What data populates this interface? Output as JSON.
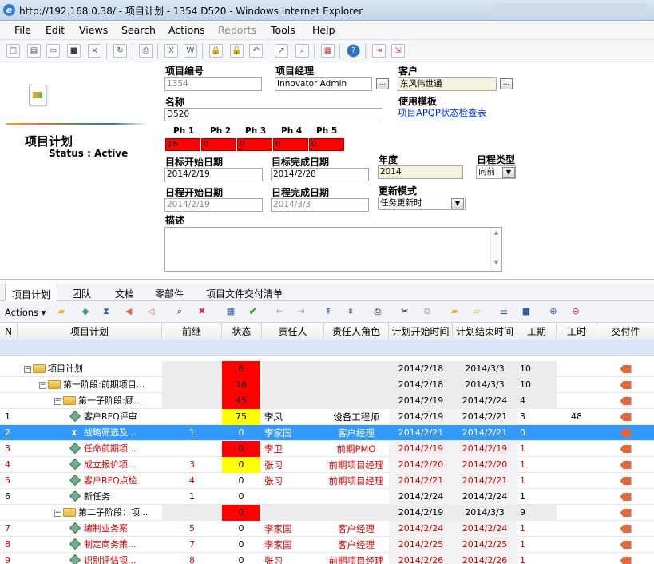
{
  "window": {
    "title": "http://192.168.0.38/ - 项目计划 - 1354 D520 - Windows Internet Explorer"
  },
  "menu": [
    "File",
    "Edit",
    "Views",
    "Search",
    "Actions",
    "Reports",
    "Tools",
    "Help"
  ],
  "header": {
    "page_title": "项目计划",
    "status": "Status : Active",
    "project_no_label": "项目编号",
    "project_no": "1354",
    "manager_label": "项目经理",
    "manager": "Innovator Admin",
    "customer_label": "客户",
    "customer": "东风伟世通",
    "template_label": "使用模板",
    "template_link": "项目APQP状态检查表",
    "name_label": "名称",
    "name": "D520",
    "phases": [
      {
        "label": "Ph 1",
        "value": "16"
      },
      {
        "label": "Ph 2",
        "value": "0"
      },
      {
        "label": "Ph 3",
        "value": "0"
      },
      {
        "label": "Ph 4",
        "value": "0"
      },
      {
        "label": "Ph 5",
        "value": "0"
      }
    ],
    "target_start_label": "目标开始日期",
    "target_start": "2014/2/19",
    "target_end_label": "目标完成日期",
    "target_end": "2014/2/28",
    "year_label": "年度",
    "year": "2014",
    "sched_type_label": "日程类型",
    "sched_type": "向前",
    "sched_start_label": "日程开始日期",
    "sched_start": "2014/2/19",
    "sched_end_label": "日程完成日期",
    "sched_end": "2014/3/3",
    "update_mode_label": "更新模式",
    "update_mode": "任务更新时",
    "desc_label": "描述"
  },
  "tabs": [
    "项目计划",
    "团队",
    "文档",
    "零部件",
    "项目文件交付清单"
  ],
  "grid": {
    "actions_label": "Actions",
    "columns": [
      "N",
      "项目计划",
      "前继",
      "状态",
      "责任人",
      "责任人角色",
      "计划开始时间",
      "计划结束时间",
      "工期",
      "工时",
      "交付件"
    ],
    "rows": [
      {
        "n": "",
        "name": "项目计划",
        "pre": "",
        "status": "6",
        "owner": "",
        "role": "",
        "ps": "2014/2/18",
        "pe": "2014/3/3",
        "dur": "10",
        "hr": "",
        "level": 0,
        "type": "folder",
        "st_color": "red",
        "red": false
      },
      {
        "n": "",
        "name": "第一阶段:前期项目...",
        "pre": "",
        "status": "16",
        "owner": "",
        "role": "",
        "ps": "2014/2/18",
        "pe": "2014/3/3",
        "dur": "10",
        "hr": "",
        "level": 1,
        "type": "folder",
        "st_color": "red",
        "red": false
      },
      {
        "n": "",
        "name": "第一子阶段:顾...",
        "pre": "",
        "status": "45",
        "owner": "",
        "role": "",
        "ps": "2014/2/19",
        "pe": "2014/2/24",
        "dur": "4",
        "hr": "",
        "level": 2,
        "type": "folder",
        "st_color": "red",
        "red": false
      },
      {
        "n": "1",
        "name": "客户RFQ评审",
        "pre": "",
        "status": "75",
        "owner": "李凤",
        "role": "设备工程师",
        "ps": "2014/2/19",
        "pe": "2014/2/21",
        "dur": "3",
        "hr": "48",
        "level": 3,
        "type": "task",
        "st_color": "yellow",
        "red": false
      },
      {
        "n": "2",
        "name": "战略筛选及...",
        "pre": "1",
        "status": "0",
        "owner": "李家国",
        "role": "客户经理",
        "ps": "2014/2/21",
        "pe": "2014/2/21",
        "dur": "0",
        "hr": "",
        "level": 3,
        "type": "milestone",
        "st_color": "",
        "red": false,
        "selected": true
      },
      {
        "n": "3",
        "name": "任命前期项...",
        "pre": "",
        "status": "0",
        "owner": "李卫",
        "role": "前期PMO",
        "ps": "2014/2/19",
        "pe": "2014/2/19",
        "dur": "1",
        "hr": "",
        "level": 3,
        "type": "task",
        "st_color": "red",
        "red": true
      },
      {
        "n": "4",
        "name": "成立报价项...",
        "pre": "3",
        "status": "0",
        "owner": "张习",
        "role": "前期项目经理",
        "ps": "2014/2/20",
        "pe": "2014/2/20",
        "dur": "1",
        "hr": "",
        "level": 3,
        "type": "task",
        "st_color": "yellow",
        "red": true
      },
      {
        "n": "5",
        "name": "客户RFQ点检",
        "pre": "4",
        "status": "0",
        "owner": "张习",
        "role": "前期项目经理",
        "ps": "2014/2/21",
        "pe": "2014/2/21",
        "dur": "1",
        "hr": "",
        "level": 3,
        "type": "task",
        "st_color": "",
        "red": true
      },
      {
        "n": "6",
        "name": "新任务",
        "pre": "1",
        "status": "0",
        "owner": "",
        "role": "",
        "ps": "2014/2/24",
        "pe": "2014/2/24",
        "dur": "1",
        "hr": "",
        "level": 3,
        "type": "task",
        "st_color": "",
        "red": false
      },
      {
        "n": "",
        "name": "第二子阶段：项...",
        "pre": "",
        "status": "0",
        "owner": "",
        "role": "",
        "ps": "2014/2/19",
        "pe": "2014/3/3",
        "dur": "9",
        "hr": "",
        "level": 2,
        "type": "folder",
        "st_color": "red",
        "red": false
      },
      {
        "n": "7",
        "name": "编制业务案",
        "pre": "5",
        "status": "0",
        "owner": "李家国",
        "role": "客户经理",
        "ps": "2014/2/24",
        "pe": "2014/2/24",
        "dur": "1",
        "hr": "",
        "level": 3,
        "type": "task",
        "st_color": "",
        "red": true
      },
      {
        "n": "8",
        "name": "制定商务策...",
        "pre": "7",
        "status": "0",
        "owner": "李家国",
        "role": "客户经理",
        "ps": "2014/2/25",
        "pe": "2014/2/25",
        "dur": "1",
        "hr": "",
        "level": 3,
        "type": "task",
        "st_color": "",
        "red": true
      },
      {
        "n": "9",
        "name": "识别评估项...",
        "pre": "8",
        "status": "0",
        "owner": "张习",
        "role": "前期项目经理",
        "ps": "2014/2/26",
        "pe": "2014/2/26",
        "dur": "1",
        "hr": "",
        "level": 3,
        "type": "task",
        "st_color": "",
        "red": true
      }
    ]
  },
  "colors": {
    "red": "#ff0000",
    "yellow": "#ffff00",
    "selected": "#3399ff",
    "link": "#0033cc"
  }
}
